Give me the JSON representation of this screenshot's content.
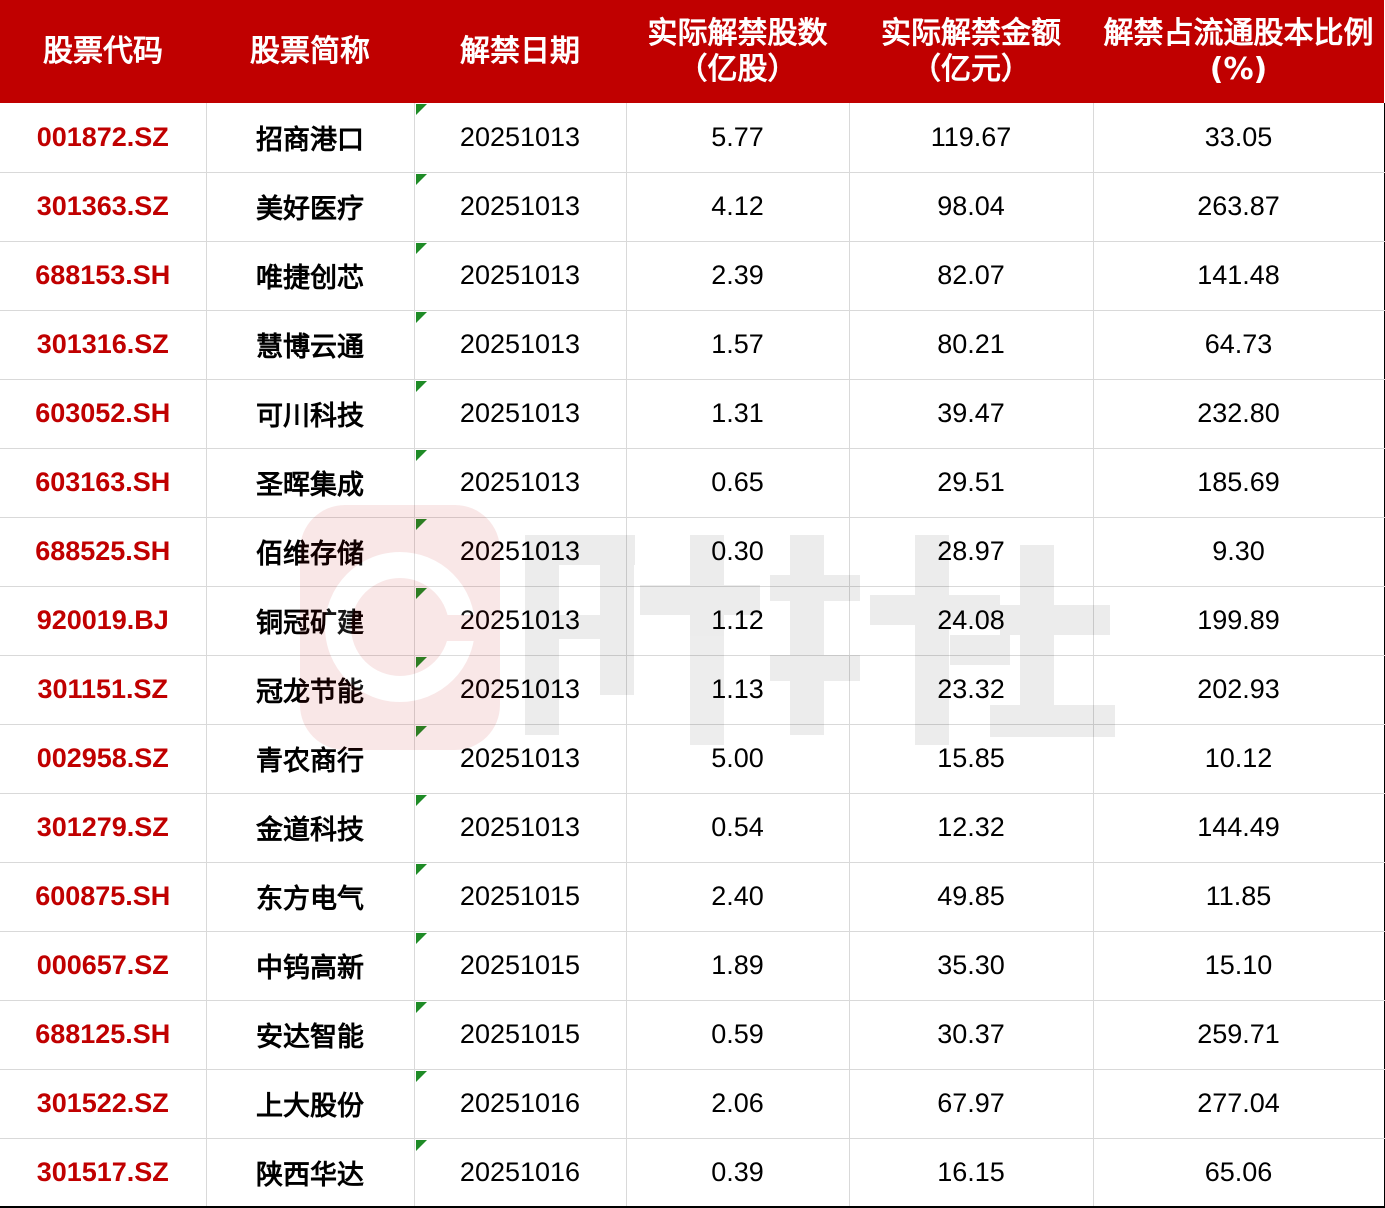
{
  "table": {
    "headers": [
      "股票代码",
      "股票简称",
      "解禁日期",
      "实际解禁股数（亿股）",
      "实际解禁金额（亿元）",
      "解禁占流通股本比例(%)"
    ],
    "rows": [
      {
        "code": "001872.SZ",
        "name": "招商港口",
        "date": "20251013",
        "shares": "5.77",
        "amount": "119.67",
        "ratio": "33.05"
      },
      {
        "code": "301363.SZ",
        "name": "美好医疗",
        "date": "20251013",
        "shares": "4.12",
        "amount": "98.04",
        "ratio": "263.87"
      },
      {
        "code": "688153.SH",
        "name": "唯捷创芯",
        "date": "20251013",
        "shares": "2.39",
        "amount": "82.07",
        "ratio": "141.48"
      },
      {
        "code": "301316.SZ",
        "name": "慧博云通",
        "date": "20251013",
        "shares": "1.57",
        "amount": "80.21",
        "ratio": "64.73"
      },
      {
        "code": "603052.SH",
        "name": "可川科技",
        "date": "20251013",
        "shares": "1.31",
        "amount": "39.47",
        "ratio": "232.80"
      },
      {
        "code": "603163.SH",
        "name": "圣晖集成",
        "date": "20251013",
        "shares": "0.65",
        "amount": "29.51",
        "ratio": "185.69"
      },
      {
        "code": "688525.SH",
        "name": "佰维存储",
        "date": "20251013",
        "shares": "0.30",
        "amount": "28.97",
        "ratio": "9.30"
      },
      {
        "code": "920019.BJ",
        "name": "铜冠矿建",
        "date": "20251013",
        "shares": "1.12",
        "amount": "24.08",
        "ratio": "199.89"
      },
      {
        "code": "301151.SZ",
        "name": "冠龙节能",
        "date": "20251013",
        "shares": "1.13",
        "amount": "23.32",
        "ratio": "202.93"
      },
      {
        "code": "002958.SZ",
        "name": "青农商行",
        "date": "20251013",
        "shares": "5.00",
        "amount": "15.85",
        "ratio": "10.12"
      },
      {
        "code": "301279.SZ",
        "name": "金道科技",
        "date": "20251013",
        "shares": "0.54",
        "amount": "12.32",
        "ratio": "144.49"
      },
      {
        "code": "600875.SH",
        "name": "东方电气",
        "date": "20251015",
        "shares": "2.40",
        "amount": "49.85",
        "ratio": "11.85"
      },
      {
        "code": "000657.SZ",
        "name": "中钨高新",
        "date": "20251015",
        "shares": "1.89",
        "amount": "35.30",
        "ratio": "15.10"
      },
      {
        "code": "688125.SH",
        "name": "安达智能",
        "date": "20251015",
        "shares": "0.59",
        "amount": "30.37",
        "ratio": "259.71"
      },
      {
        "code": "301522.SZ",
        "name": "上大股份",
        "date": "20251016",
        "shares": "2.06",
        "amount": "67.97",
        "ratio": "277.04"
      },
      {
        "code": "301517.SZ",
        "name": "陕西华达",
        "date": "20251016",
        "shares": "0.39",
        "amount": "16.15",
        "ratio": "65.06"
      }
    ]
  },
  "watermark": {
    "text": "财联社",
    "logo": "cls-logo-icon"
  },
  "colors": {
    "header_bg": "#c00000",
    "header_text": "#ffffff",
    "code_text": "#c00000",
    "cell_marker": "#1e8b26",
    "grid": "#d9d9d9"
  }
}
